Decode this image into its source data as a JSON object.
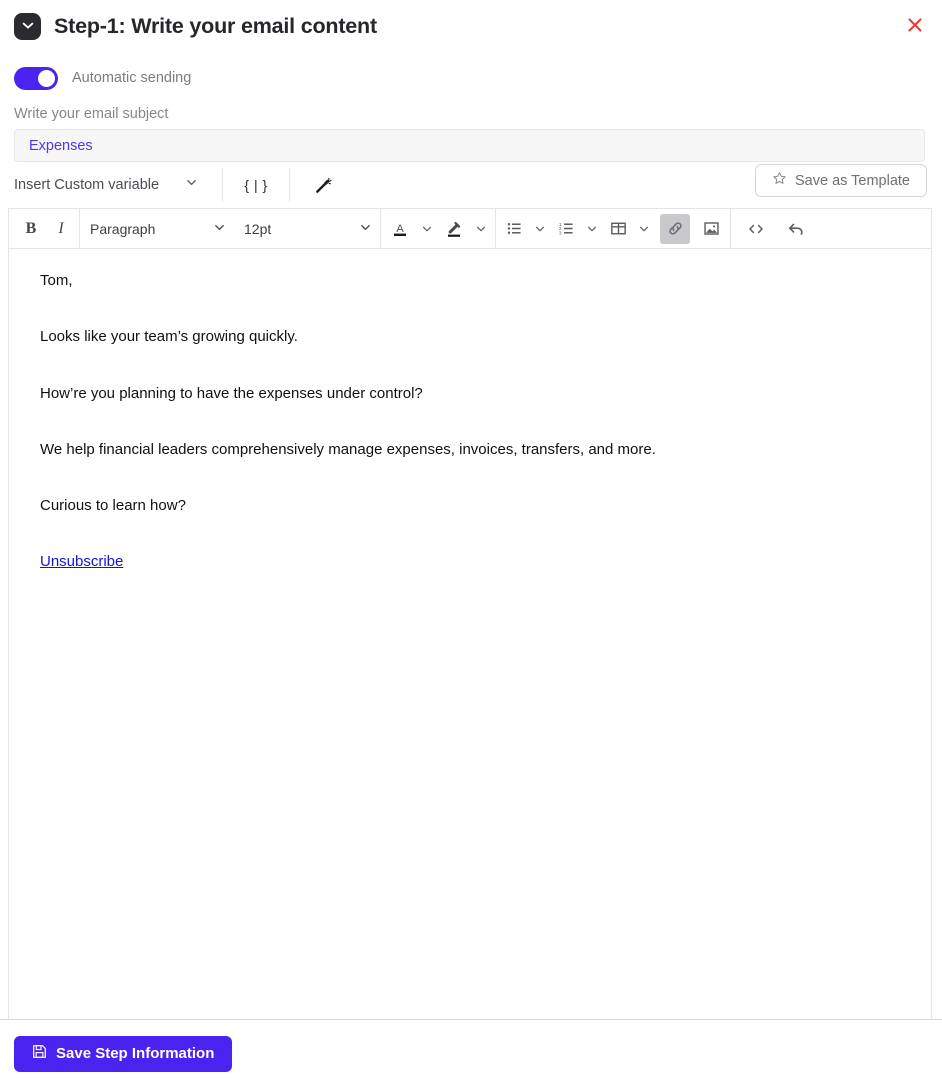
{
  "header": {
    "icon": "mail-icon",
    "title": "Step-1:  Write your email content",
    "close_icon": "close-icon",
    "close_color": "#ee3b33"
  },
  "automatic_sending": {
    "label": "Automatic sending",
    "enabled": true,
    "accent_color": "#4b23f0"
  },
  "subject": {
    "label": "Write your email subject",
    "value": "Expenses",
    "placeholder": "Write your email subject",
    "text_color": "#5432ef"
  },
  "variable_bar": {
    "insert_variable_label": "Insert Custom variable",
    "braces_icon_label": "{ | }",
    "magic_wand_icon": "magic-wand-icon",
    "save_template_label": "Save as Template",
    "save_template_icon": "star-icon"
  },
  "toolbar": {
    "bold_label": "B",
    "italic_label": "I",
    "paragraph_value": "Paragraph",
    "font_size_value": "12pt",
    "buttons": [
      {
        "name": "text-color",
        "label": "A",
        "active": false
      },
      {
        "name": "highlight-color",
        "label": "",
        "active": false
      },
      {
        "name": "bullet-list",
        "label": "",
        "active": false
      },
      {
        "name": "numbered-list",
        "label": "",
        "active": false
      },
      {
        "name": "table",
        "label": "",
        "active": false
      },
      {
        "name": "link",
        "label": "",
        "active": true
      },
      {
        "name": "image",
        "label": "",
        "active": false
      },
      {
        "name": "source-code",
        "label": "",
        "active": false
      },
      {
        "name": "undo",
        "label": "",
        "active": false
      }
    ]
  },
  "email_body": {
    "paragraphs": [
      "Tom,",
      "Looks like your team’s growing quickly.",
      "How’re you planning to have the expenses under control?",
      "We help financial leaders comprehensively manage expenses, invoices, transfers, and more.",
      "Curious to learn how?"
    ],
    "unsubscribe_label": "Unsubscribe",
    "unsubscribe_color": "#1414e0"
  },
  "footer": {
    "save_label": "Save Step Information",
    "save_icon": "floppy-disk-icon",
    "save_color": "#4b23f0"
  }
}
